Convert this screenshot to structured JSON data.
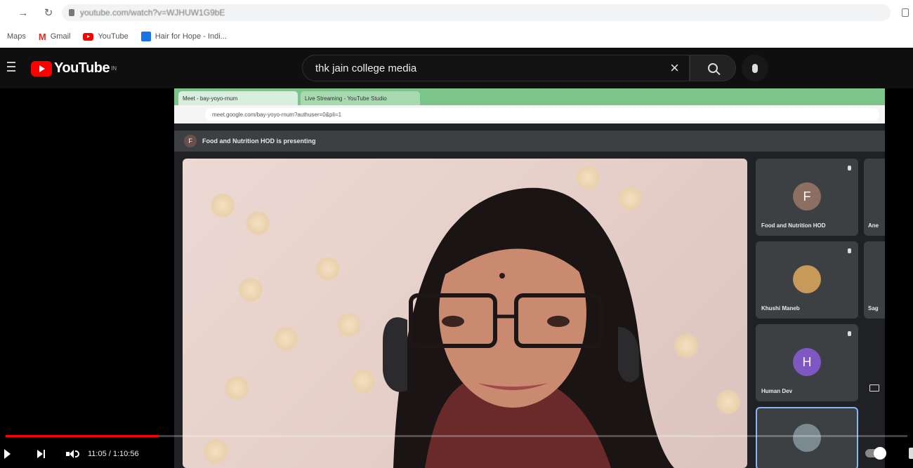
{
  "browser": {
    "url": "youtube.com/watch?v=WJHUW1G9bE",
    "bookmarks": [
      {
        "label": "Maps"
      },
      {
        "label": "Gmail"
      },
      {
        "label": "YouTube"
      },
      {
        "label": "Hair for Hope - Indi..."
      }
    ]
  },
  "youtube": {
    "logo_text": "YouTube",
    "logo_sup": "IN",
    "search_query": "thk jain college media"
  },
  "video": {
    "inner_tabs": [
      "Meet - bay-yoyo-rnum",
      "Live Streaming - YouTube Studio"
    ],
    "inner_url": "meet.google.com/bay-yoyo-rnum?authuser=0&pli=1",
    "presenting_initial": "F",
    "presenting_text": "Food and Nutrition HOD is presenting",
    "participants": [
      {
        "initial": "F",
        "name": "Food and Nutrition HOD",
        "color": "#8d6e63"
      },
      {
        "initial": "",
        "name": "Khushi Maneb",
        "color": "#c79a5a"
      },
      {
        "initial": "H",
        "name": "Human Dev",
        "color": "#7e57c2"
      },
      {
        "initial": "",
        "name": "",
        "color": "#7a8a90"
      }
    ],
    "side_names": [
      "Ane",
      "Sag"
    ],
    "progress": 0.17,
    "time": "11:05 / 1:10:56",
    "accent_red": "#ff0000"
  }
}
